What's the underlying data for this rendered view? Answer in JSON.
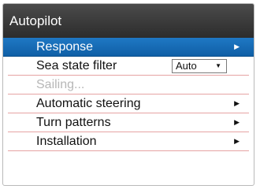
{
  "window": {
    "title": "Autopilot"
  },
  "menu": {
    "items": [
      {
        "label": "Response"
      },
      {
        "label": "Sea state filter",
        "select_value": "Auto"
      },
      {
        "label": "Sailing..."
      },
      {
        "label": "Automatic steering"
      },
      {
        "label": "Turn patterns"
      },
      {
        "label": "Installation"
      }
    ]
  },
  "icons": {
    "chevron_right": "chevron-right-icon",
    "dropdown_caret": "caret-down-icon"
  },
  "colors": {
    "title_bar": "#2c2c2c",
    "selection": "#1469b5",
    "separator": "#e6a3a3",
    "disabled_text": "#b7b7b7"
  }
}
